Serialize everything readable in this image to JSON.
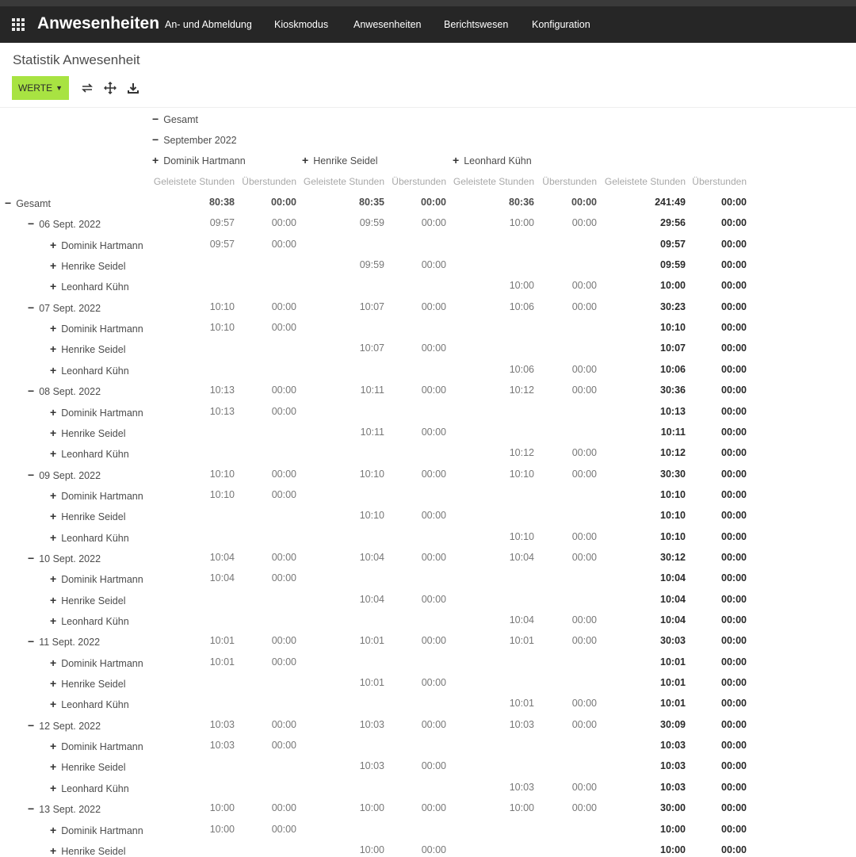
{
  "app": {
    "title": "Anwesenheiten"
  },
  "menu": [
    "An- und Abmeldung",
    "Kioskmodus",
    "Anwesenheiten",
    "Berichtswesen",
    "Konfiguration"
  ],
  "page": {
    "title": "Statistik Anwesenheit"
  },
  "toolbar": {
    "werte_label": "WERTE",
    "icons": [
      "swap-axis-icon",
      "expand-all-icon",
      "download-icon"
    ]
  },
  "header": {
    "total": "Gesamt",
    "period": "September 2022",
    "people": [
      "Dominik Hartmann",
      "Henrike Seidel",
      "Leonhard Kühn"
    ],
    "measure_labels": [
      "Geleistete Stunden",
      "Überstunden"
    ]
  },
  "rows": [
    {
      "label": "Gesamt",
      "level": 0,
      "sign": "−",
      "values": [
        "80:38",
        "00:00",
        "80:35",
        "00:00",
        "80:36",
        "00:00",
        "241:49",
        "00:00"
      ]
    },
    {
      "label": "06 Sept. 2022",
      "level": 1,
      "sign": "−",
      "values": [
        "09:57",
        "00:00",
        "09:59",
        "00:00",
        "10:00",
        "00:00",
        "29:56",
        "00:00"
      ]
    },
    {
      "label": "Dominik Hartmann",
      "level": 2,
      "sign": "+",
      "values": [
        "09:57",
        "00:00",
        "",
        "",
        "",
        "",
        "09:57",
        "00:00"
      ]
    },
    {
      "label": "Henrike Seidel",
      "level": 2,
      "sign": "+",
      "values": [
        "",
        "",
        "09:59",
        "00:00",
        "",
        "",
        "09:59",
        "00:00"
      ]
    },
    {
      "label": "Leonhard Kühn",
      "level": 2,
      "sign": "+",
      "values": [
        "",
        "",
        "",
        "",
        "10:00",
        "00:00",
        "10:00",
        "00:00"
      ]
    },
    {
      "label": "07 Sept. 2022",
      "level": 1,
      "sign": "−",
      "values": [
        "10:10",
        "00:00",
        "10:07",
        "00:00",
        "10:06",
        "00:00",
        "30:23",
        "00:00"
      ]
    },
    {
      "label": "Dominik Hartmann",
      "level": 2,
      "sign": "+",
      "values": [
        "10:10",
        "00:00",
        "",
        "",
        "",
        "",
        "10:10",
        "00:00"
      ]
    },
    {
      "label": "Henrike Seidel",
      "level": 2,
      "sign": "+",
      "values": [
        "",
        "",
        "10:07",
        "00:00",
        "",
        "",
        "10:07",
        "00:00"
      ]
    },
    {
      "label": "Leonhard Kühn",
      "level": 2,
      "sign": "+",
      "values": [
        "",
        "",
        "",
        "",
        "10:06",
        "00:00",
        "10:06",
        "00:00"
      ]
    },
    {
      "label": "08 Sept. 2022",
      "level": 1,
      "sign": "−",
      "values": [
        "10:13",
        "00:00",
        "10:11",
        "00:00",
        "10:12",
        "00:00",
        "30:36",
        "00:00"
      ]
    },
    {
      "label": "Dominik Hartmann",
      "level": 2,
      "sign": "+",
      "values": [
        "10:13",
        "00:00",
        "",
        "",
        "",
        "",
        "10:13",
        "00:00"
      ]
    },
    {
      "label": "Henrike Seidel",
      "level": 2,
      "sign": "+",
      "values": [
        "",
        "",
        "10:11",
        "00:00",
        "",
        "",
        "10:11",
        "00:00"
      ]
    },
    {
      "label": "Leonhard Kühn",
      "level": 2,
      "sign": "+",
      "values": [
        "",
        "",
        "",
        "",
        "10:12",
        "00:00",
        "10:12",
        "00:00"
      ]
    },
    {
      "label": "09 Sept. 2022",
      "level": 1,
      "sign": "−",
      "values": [
        "10:10",
        "00:00",
        "10:10",
        "00:00",
        "10:10",
        "00:00",
        "30:30",
        "00:00"
      ]
    },
    {
      "label": "Dominik Hartmann",
      "level": 2,
      "sign": "+",
      "values": [
        "10:10",
        "00:00",
        "",
        "",
        "",
        "",
        "10:10",
        "00:00"
      ]
    },
    {
      "label": "Henrike Seidel",
      "level": 2,
      "sign": "+",
      "values": [
        "",
        "",
        "10:10",
        "00:00",
        "",
        "",
        "10:10",
        "00:00"
      ]
    },
    {
      "label": "Leonhard Kühn",
      "level": 2,
      "sign": "+",
      "values": [
        "",
        "",
        "",
        "",
        "10:10",
        "00:00",
        "10:10",
        "00:00"
      ]
    },
    {
      "label": "10 Sept. 2022",
      "level": 1,
      "sign": "−",
      "values": [
        "10:04",
        "00:00",
        "10:04",
        "00:00",
        "10:04",
        "00:00",
        "30:12",
        "00:00"
      ]
    },
    {
      "label": "Dominik Hartmann",
      "level": 2,
      "sign": "+",
      "values": [
        "10:04",
        "00:00",
        "",
        "",
        "",
        "",
        "10:04",
        "00:00"
      ]
    },
    {
      "label": "Henrike Seidel",
      "level": 2,
      "sign": "+",
      "values": [
        "",
        "",
        "10:04",
        "00:00",
        "",
        "",
        "10:04",
        "00:00"
      ]
    },
    {
      "label": "Leonhard Kühn",
      "level": 2,
      "sign": "+",
      "values": [
        "",
        "",
        "",
        "",
        "10:04",
        "00:00",
        "10:04",
        "00:00"
      ]
    },
    {
      "label": "11 Sept. 2022",
      "level": 1,
      "sign": "−",
      "values": [
        "10:01",
        "00:00",
        "10:01",
        "00:00",
        "10:01",
        "00:00",
        "30:03",
        "00:00"
      ]
    },
    {
      "label": "Dominik Hartmann",
      "level": 2,
      "sign": "+",
      "values": [
        "10:01",
        "00:00",
        "",
        "",
        "",
        "",
        "10:01",
        "00:00"
      ]
    },
    {
      "label": "Henrike Seidel",
      "level": 2,
      "sign": "+",
      "values": [
        "",
        "",
        "10:01",
        "00:00",
        "",
        "",
        "10:01",
        "00:00"
      ]
    },
    {
      "label": "Leonhard Kühn",
      "level": 2,
      "sign": "+",
      "values": [
        "",
        "",
        "",
        "",
        "10:01",
        "00:00",
        "10:01",
        "00:00"
      ]
    },
    {
      "label": "12 Sept. 2022",
      "level": 1,
      "sign": "−",
      "values": [
        "10:03",
        "00:00",
        "10:03",
        "00:00",
        "10:03",
        "00:00",
        "30:09",
        "00:00"
      ]
    },
    {
      "label": "Dominik Hartmann",
      "level": 2,
      "sign": "+",
      "values": [
        "10:03",
        "00:00",
        "",
        "",
        "",
        "",
        "10:03",
        "00:00"
      ]
    },
    {
      "label": "Henrike Seidel",
      "level": 2,
      "sign": "+",
      "values": [
        "",
        "",
        "10:03",
        "00:00",
        "",
        "",
        "10:03",
        "00:00"
      ]
    },
    {
      "label": "Leonhard Kühn",
      "level": 2,
      "sign": "+",
      "values": [
        "",
        "",
        "",
        "",
        "10:03",
        "00:00",
        "10:03",
        "00:00"
      ]
    },
    {
      "label": "13 Sept. 2022",
      "level": 1,
      "sign": "−",
      "values": [
        "10:00",
        "00:00",
        "10:00",
        "00:00",
        "10:00",
        "00:00",
        "30:00",
        "00:00"
      ]
    },
    {
      "label": "Dominik Hartmann",
      "level": 2,
      "sign": "+",
      "values": [
        "10:00",
        "00:00",
        "",
        "",
        "",
        "",
        "10:00",
        "00:00"
      ]
    },
    {
      "label": "Henrike Seidel",
      "level": 2,
      "sign": "+",
      "values": [
        "",
        "",
        "10:00",
        "00:00",
        "",
        "",
        "10:00",
        "00:00"
      ]
    }
  ]
}
